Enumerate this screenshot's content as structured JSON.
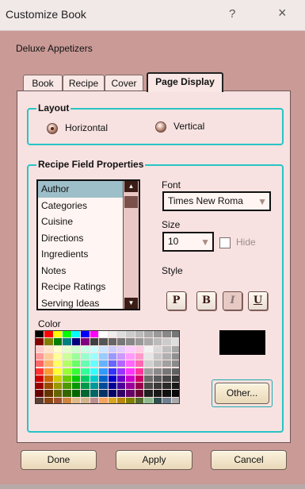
{
  "window": {
    "title": "Customize Book",
    "help_icon": "?",
    "close_icon": "×"
  },
  "book": {
    "name": "Deluxe Appetizers"
  },
  "tabs": [
    {
      "label": "Book"
    },
    {
      "label": "Recipe"
    },
    {
      "label": "Cover"
    },
    {
      "label": "Page Display",
      "active": true
    }
  ],
  "layout": {
    "legend": "Layout",
    "selected": "Horizontal",
    "options": [
      {
        "label": "Horizontal"
      },
      {
        "label": "Vertical"
      }
    ]
  },
  "recipe_fields": {
    "legend": "Recipe Field Properties",
    "selected": "Author",
    "items": [
      {
        "label": "Author"
      },
      {
        "label": "Categories"
      },
      {
        "label": "Cuisine"
      },
      {
        "label": "Directions"
      },
      {
        "label": "Ingredients"
      },
      {
        "label": "Notes"
      },
      {
        "label": "Recipe Ratings"
      },
      {
        "label": "Serving Ideas"
      }
    ]
  },
  "font": {
    "label": "Font",
    "value": "Times New Roma"
  },
  "size": {
    "label": "Size",
    "value": "10"
  },
  "hide": {
    "label": "Hide",
    "checked": false
  },
  "style": {
    "label": "Style",
    "buttons": [
      {
        "label": "P"
      },
      {
        "label": "B"
      },
      {
        "label": "I",
        "active": true
      },
      {
        "label": "U"
      }
    ]
  },
  "color": {
    "label": "Color",
    "selected_color": "#000000",
    "palette": [
      [
        "#000000",
        "#ff0000",
        "#ffff00",
        "#00ff00",
        "#00ffff",
        "#0000ff",
        "#ff00ff",
        "#ffffff",
        "#eeeeee",
        "#dddddd",
        "#cccccc",
        "#bbbbbb",
        "#aaaaaa",
        "#999999",
        "#888888",
        "#777777"
      ],
      [
        "#800000",
        "#808000",
        "#008000",
        "#008080",
        "#000080",
        "#800080",
        "#404040",
        "#555555",
        "#666666",
        "#777777",
        "#888888",
        "#999999",
        "#aaaaaa",
        "#bbbbbb",
        "#cccccc",
        "#dddddd"
      ],
      [
        "#ffcccc",
        "#ffe5cc",
        "#ffffcc",
        "#e5ffcc",
        "#ccffcc",
        "#ccffe5",
        "#ccffff",
        "#cce5ff",
        "#ccccff",
        "#e5ccff",
        "#ffccff",
        "#ffcce5",
        "#f2f2f2",
        "#d9d9d9",
        "#bfbfbf",
        "#a6a6a6"
      ],
      [
        "#ff9999",
        "#ffcc99",
        "#ffff99",
        "#ccff99",
        "#99ff99",
        "#99ffcc",
        "#99ffff",
        "#99ccff",
        "#9999ff",
        "#cc99ff",
        "#ff99ff",
        "#ff99cc",
        "#e6e6e6",
        "#c8c8c8",
        "#b0b0b0",
        "#909090"
      ],
      [
        "#ff6666",
        "#ffb266",
        "#ffff66",
        "#b2ff66",
        "#66ff66",
        "#66ffb2",
        "#66ffff",
        "#66b2ff",
        "#6666ff",
        "#b266ff",
        "#ff66ff",
        "#ff66b2",
        "#d0d0d0",
        "#b8b8b8",
        "#a0a0a0",
        "#8a8a8a"
      ],
      [
        "#ff3333",
        "#ff9933",
        "#ffff33",
        "#99ff33",
        "#33ff33",
        "#33ff99",
        "#33ffff",
        "#3399ff",
        "#3333ff",
        "#9933ff",
        "#ff33ff",
        "#ff3399",
        "#9e9e9e",
        "#8a8a8a",
        "#777777",
        "#616161"
      ],
      [
        "#cc0000",
        "#cc6600",
        "#cccc00",
        "#66cc00",
        "#00cc00",
        "#00cc66",
        "#00cccc",
        "#0066cc",
        "#0000cc",
        "#6600cc",
        "#cc00cc",
        "#cc0066",
        "#6b6b6b",
        "#595959",
        "#474747",
        "#353535"
      ],
      [
        "#990000",
        "#994c00",
        "#999900",
        "#4c9900",
        "#009900",
        "#00994c",
        "#009999",
        "#004c99",
        "#000099",
        "#4c0099",
        "#990099",
        "#99004c",
        "#4a4a4a",
        "#3a3a3a",
        "#2a2a2a",
        "#1a1a1a"
      ],
      [
        "#660000",
        "#663300",
        "#666600",
        "#336600",
        "#006600",
        "#006633",
        "#006666",
        "#003366",
        "#000066",
        "#330066",
        "#660066",
        "#660033",
        "#202020",
        "#181818",
        "#101010",
        "#080808"
      ],
      [
        "#5c4033",
        "#8b4513",
        "#a0522d",
        "#cd853f",
        "#deb887",
        "#d2b48c",
        "#bc8f8f",
        "#f4a460",
        "#daa520",
        "#b8860b",
        "#808000",
        "#556b2f",
        "#8fbc8f",
        "#2f4f4f",
        "#708090",
        "#a9a9a9"
      ]
    ],
    "other_label": "Other..."
  },
  "buttons": {
    "done": "Done",
    "apply": "Apply",
    "cancel": "Cancel"
  }
}
